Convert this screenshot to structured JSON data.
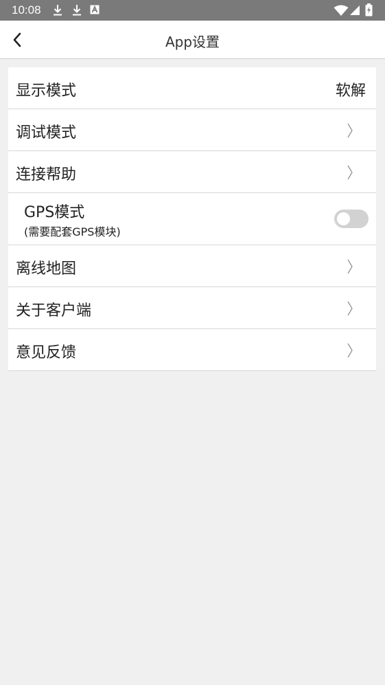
{
  "status_bar": {
    "time": "10:08",
    "left_icons": [
      "download-icon",
      "download-icon",
      "a-badge-icon"
    ],
    "right_icons": [
      "wifi-icon",
      "cellular-signal-icon",
      "battery-charging-icon"
    ],
    "background": "#7a7a7a"
  },
  "header": {
    "title": "App设置",
    "back_icon": "chevron-left-icon"
  },
  "settings": {
    "display_mode": {
      "label": "显示模式",
      "value": "软解"
    },
    "debug_mode": {
      "label": "调试模式"
    },
    "connection_help": {
      "label": "连接帮助"
    },
    "gps_mode": {
      "label": "GPS模式",
      "sublabel": "(需要配套GPS模块)",
      "enabled": false
    },
    "offline_map": {
      "label": "离线地图"
    },
    "about": {
      "label": "关于客户端"
    },
    "feedback": {
      "label": "意见反馈"
    }
  },
  "colors": {
    "page_background": "#f0f0f0",
    "card_background": "#ffffff",
    "divider": "#d6d6d6",
    "toggle_off": "#d2d2d2"
  }
}
